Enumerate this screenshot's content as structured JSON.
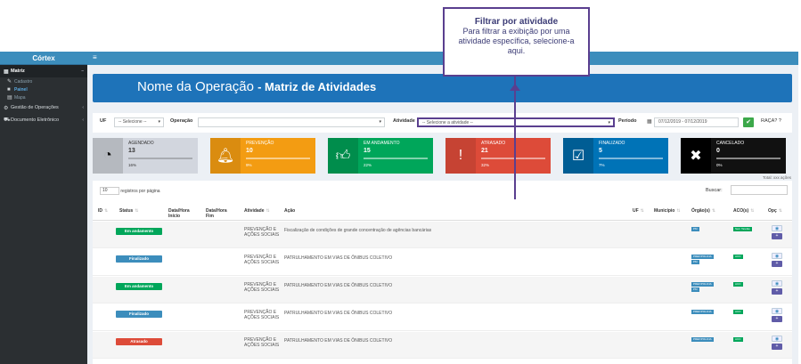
{
  "app": {
    "brand": "Córtex"
  },
  "sidebar": {
    "items": [
      {
        "label": "Matriz",
        "icon": "grid-icon",
        "active": true
      },
      {
        "label": "Gestão de Operações",
        "icon": "wrench-icon"
      },
      {
        "label": "Documento Eletrônico",
        "icon": "car-icon"
      }
    ],
    "submenu": [
      {
        "label": "Cadastro"
      },
      {
        "label": "Painel",
        "current": true
      },
      {
        "label": "Mapa"
      }
    ]
  },
  "banner": {
    "operation": "Nome da Operação",
    "subtitle": "- Matriz de Atividades"
  },
  "filters": {
    "uf_label": "UF",
    "uf_value": "-- Selecione --",
    "operacao_label": "Operação",
    "atividade_label": "Atividade",
    "atividade_placeholder": "-- Selecione a atividade --",
    "periodo_label": "Período",
    "periodo_value": "07/12/2019 - 07/12/2019",
    "recent_label": "RAÇA? ?"
  },
  "cards": [
    {
      "name": "AGENDADO",
      "count": "13",
      "pct": "16%",
      "color": "grey",
      "icon": "clock-icon"
    },
    {
      "name": "PREVENÇÃO",
      "count": "10",
      "pct": "9%",
      "color": "orange",
      "icon": "bell-icon"
    },
    {
      "name": "EM ANDAMENTO",
      "count": "15",
      "pct": "22%",
      "color": "green",
      "icon": "thumbs-up-icon"
    },
    {
      "name": "ATRASADO",
      "count": "21",
      "pct": "32%",
      "color": "red",
      "icon": "exclamation-icon"
    },
    {
      "name": "FINALIZADO",
      "count": "5",
      "pct": "7%",
      "color": "blue",
      "icon": "checkbox-icon"
    },
    {
      "name": "CANCELADO",
      "count": "0",
      "pct": "0%",
      "color": "black",
      "icon": "x-icon"
    }
  ],
  "legend_note": "Total: xxx ações",
  "table": {
    "length_value": "10",
    "length_label": "registros por página",
    "search_label": "Buscar:",
    "headers": {
      "id": "ID",
      "status": "Status",
      "inicio": "Data/Hora Início",
      "fim": "Data/Hora Fim",
      "atividade": "Atividade",
      "acao": "Ação",
      "uf": "UF",
      "municipio": "Município",
      "orgao": "Órgão(s)",
      "aco": "ACO(s)",
      "opc": "Opç"
    },
    "rows": [
      {
        "status": "Em andamento",
        "status_color": "green",
        "atividade": "PREVENÇÃO E AÇÕES SOCIAIS",
        "acao": "Fiscalização de condições de grande concentração de agências bancárias",
        "orgao": "PM",
        "orgao2": "",
        "aco": "Sem Tarefas"
      },
      {
        "status": "Finalizado",
        "status_color": "blue",
        "atividade": "PREVENÇÃO E AÇÕES SOCIAIS",
        "acao": "PATRULHAMENTO EM VIAS DE ÔNIBUS COLETIVO",
        "orgao": "PREF/POLICIA",
        "orgao2": "PM",
        "aco": "ACO"
      },
      {
        "status": "Em andamento",
        "status_color": "green",
        "atividade": "PREVENÇÃO E AÇÕES SOCIAIS",
        "acao": "PATRULHAMENTO EM VIAS DE ÔNIBUS COLETIVO",
        "orgao": "PREF/POLICIA",
        "orgao2": "PM",
        "aco": "ACO"
      },
      {
        "status": "Finalizado",
        "status_color": "blue",
        "atividade": "PREVENÇÃO E AÇÕES SOCIAIS",
        "acao": "PATRULHAMENTO EM VIAS DE ÔNIBUS COLETIVO",
        "orgao": "PREF/POLICIA",
        "orgao2": "",
        "aco": "ACO"
      },
      {
        "status": "Atrasado",
        "status_color": "red",
        "atividade": "PREVENÇÃO E AÇÕES SOCIAIS",
        "acao": "PATRULHAMENTO EM VIAS DE ÔNIBUS COLETIVO",
        "orgao": "PREF/POLICIA",
        "orgao2": "",
        "aco": "ACO"
      }
    ]
  },
  "callout": {
    "title": "Filtrar por atividade",
    "text": "Para filtrar a exibição por uma atividade específica, selecione-a aqui."
  }
}
